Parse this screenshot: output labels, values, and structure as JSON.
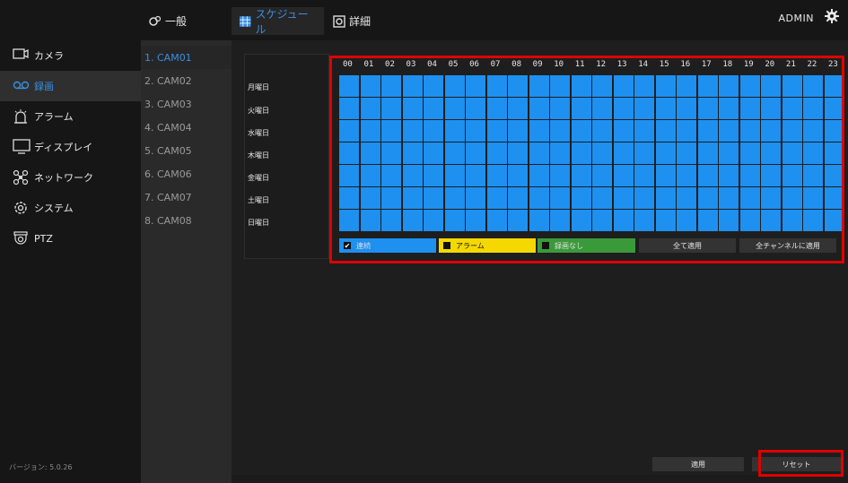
{
  "topbar": {
    "tabs": [
      {
        "label": "一般",
        "icon": "general-icon"
      },
      {
        "label": "スケジュール",
        "icon": "calendar-icon"
      },
      {
        "label": "詳細",
        "icon": "detail-icon"
      }
    ],
    "user": "ADMIN"
  },
  "sidebar": {
    "items": [
      {
        "label": "カメラ"
      },
      {
        "label": "録画"
      },
      {
        "label": "アラーム"
      },
      {
        "label": "ディスプレイ"
      },
      {
        "label": "ネットワーク"
      },
      {
        "label": "システム"
      },
      {
        "label": "PTZ"
      }
    ],
    "version": "バージョン: 5.0.26"
  },
  "cameras": [
    "1. CAM01",
    "2. CAM02",
    "3. CAM03",
    "4. CAM04",
    "5. CAM05",
    "6. CAM06",
    "7. CAM07",
    "8. CAM08"
  ],
  "schedule": {
    "days": [
      "月曜日",
      "火曜日",
      "水曜日",
      "木曜日",
      "金曜日",
      "土曜日",
      "日曜日"
    ],
    "hours": [
      "00",
      "01",
      "02",
      "03",
      "04",
      "05",
      "06",
      "07",
      "08",
      "09",
      "10",
      "11",
      "12",
      "13",
      "14",
      "15",
      "16",
      "17",
      "18",
      "19",
      "20",
      "21",
      "22",
      "23"
    ],
    "legend": {
      "continuous": "連続",
      "alarm": "アラーム",
      "none": "録画なし"
    },
    "apply_all": "全て適用",
    "apply_all_channels": "全チャンネルに適用",
    "colors": {
      "continuous": "#1e90f0",
      "alarm": "#f5d800",
      "none": "#3a9a3a"
    }
  },
  "footer": {
    "apply": "適用",
    "reset": "リセット"
  }
}
